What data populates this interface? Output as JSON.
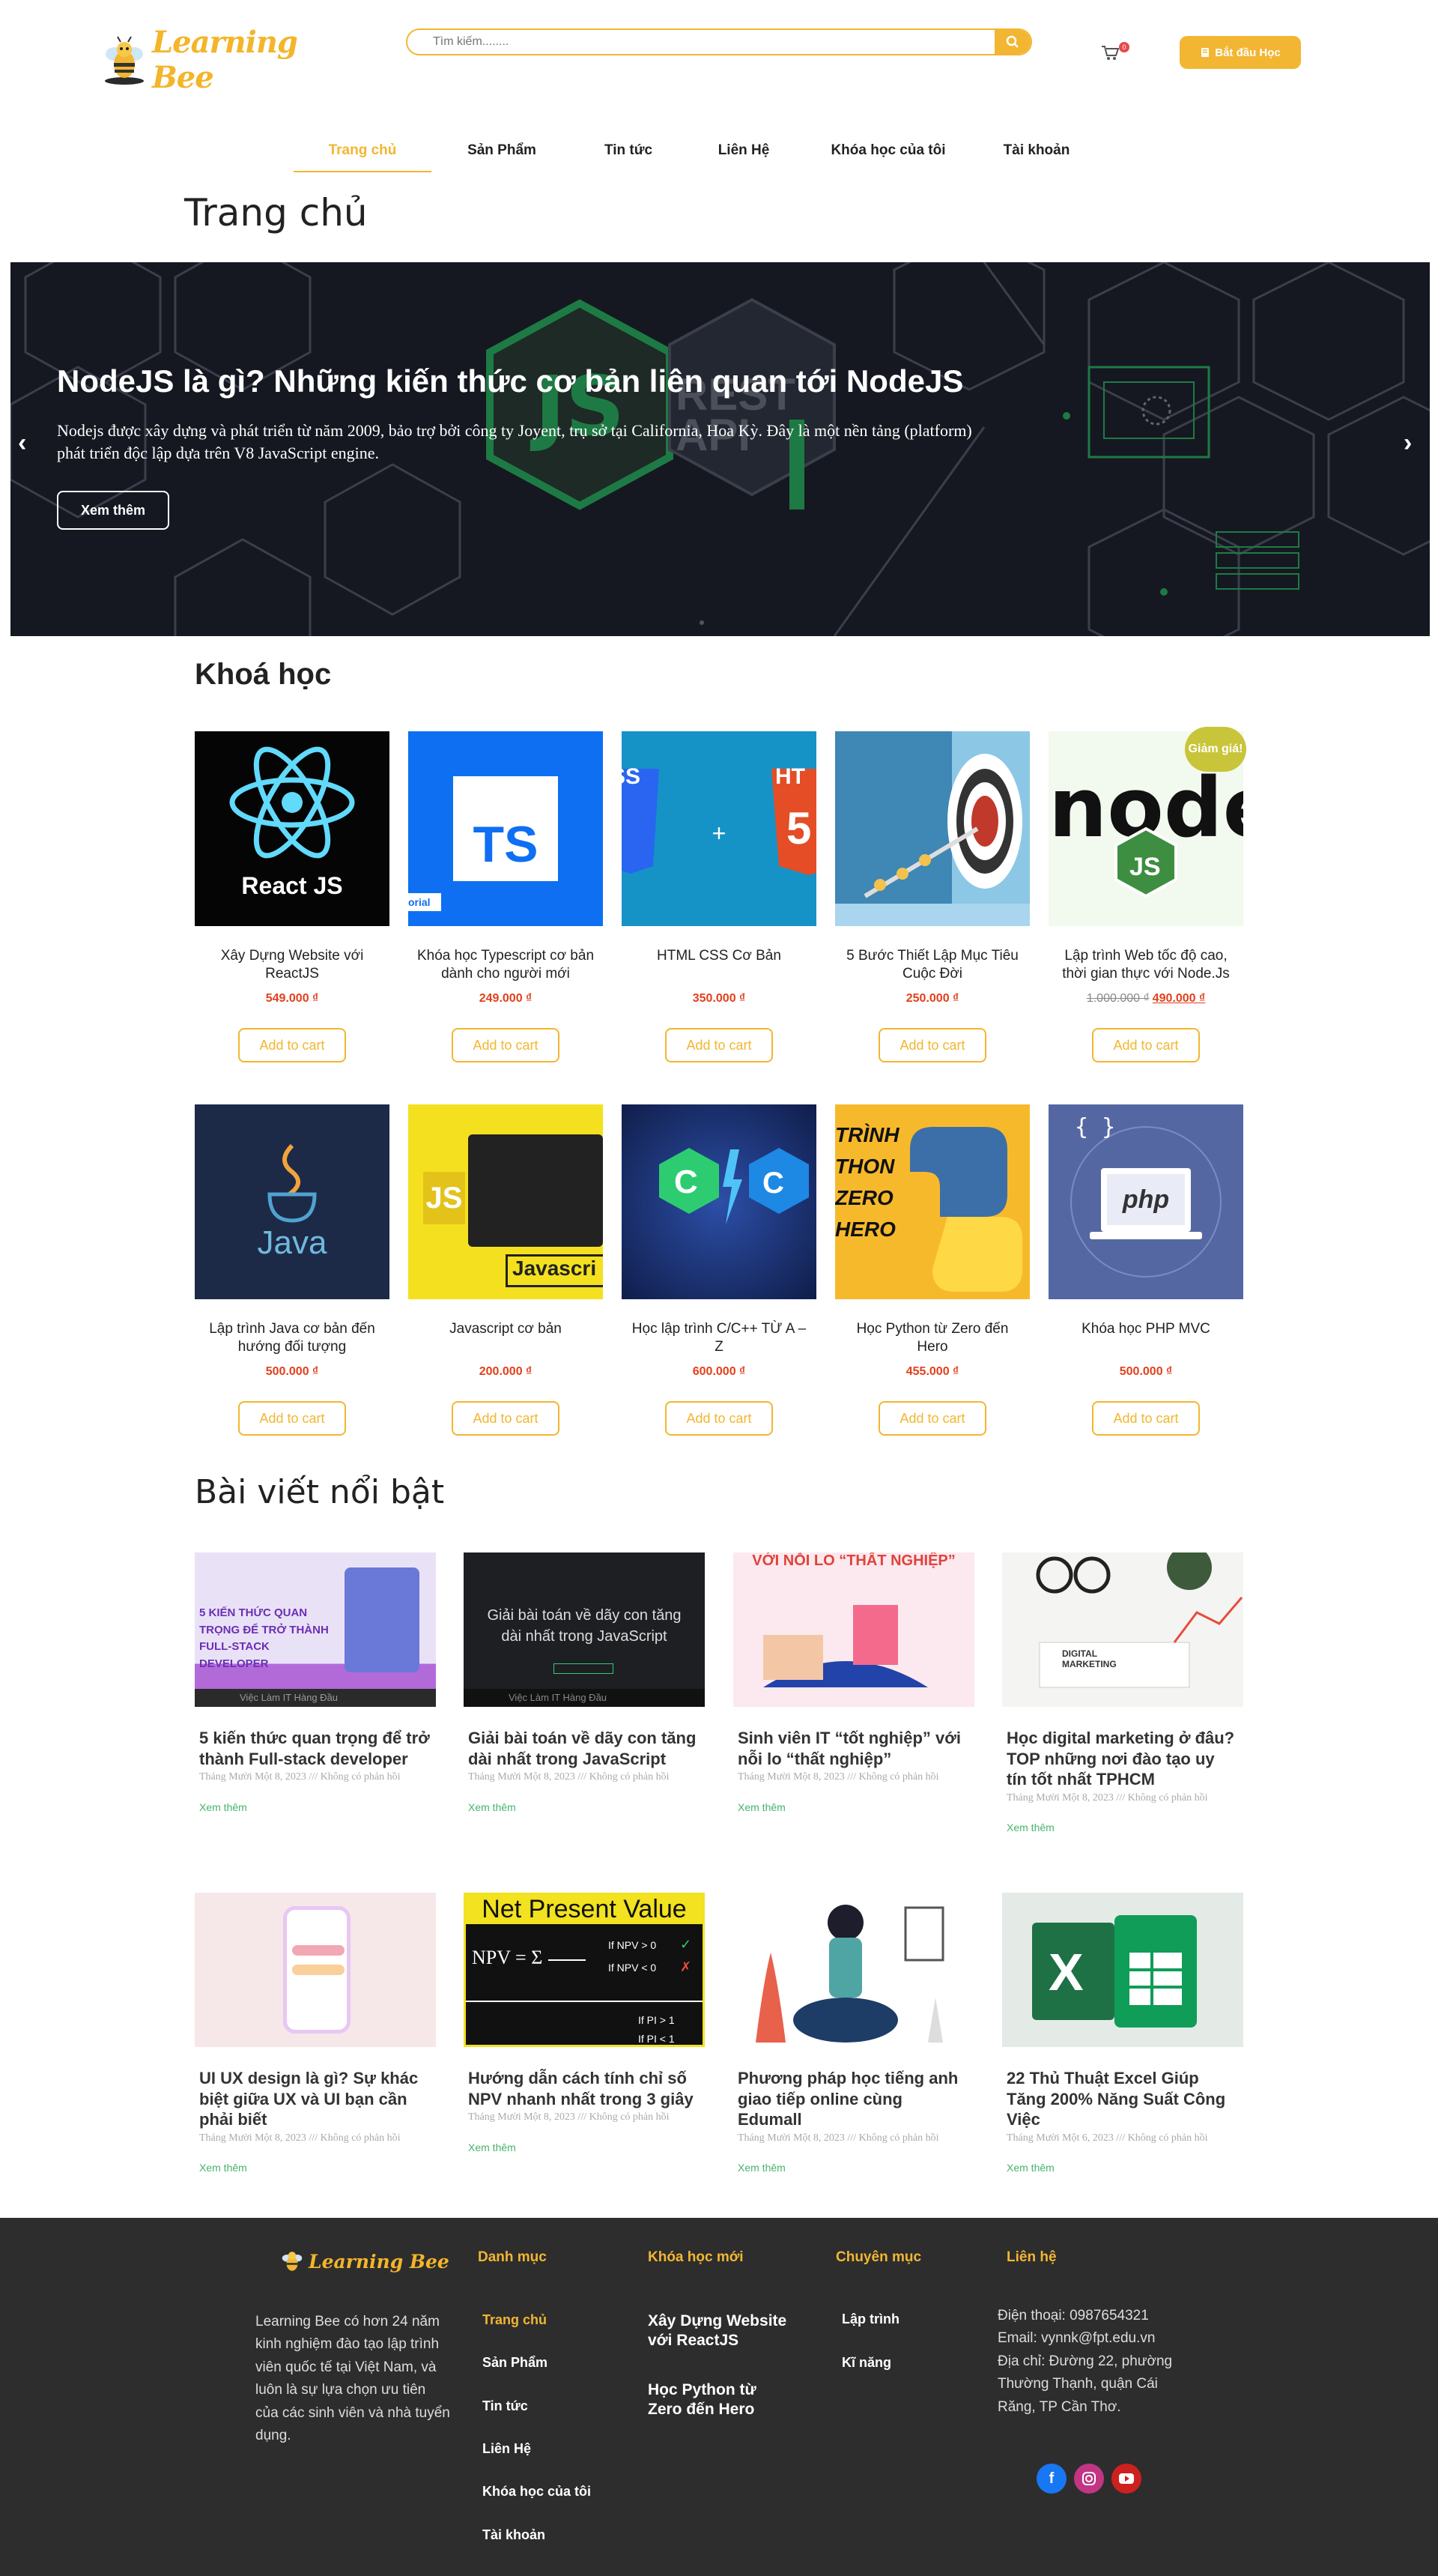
{
  "brand": {
    "name": "Learning Bee"
  },
  "search": {
    "placeholder": "Tìm kiếm........"
  },
  "cart": {
    "count": "0"
  },
  "cta": {
    "label": "Bắt đầu Học"
  },
  "nav": [
    "Trang chủ",
    "Sản Phẩm",
    "Tin tức",
    "Liên Hệ",
    "Khóa học của tôi",
    "Tài khoản"
  ],
  "page_title": "Trang chủ",
  "hero": {
    "title": "NodeJS là gì? Những kiến thức cơ bản liên quan tới NodeJS",
    "description": "Nodejs được xây dựng và phát triển từ năm 2009, bảo trợ bởi công ty Joyent, trụ sở tại California, Hoa Kỳ. Đây là một nền tảng (platform) phát triển độc lập dựa trên V8 JavaScript engine.",
    "button": "Xem thêm",
    "bg_text": "REST API"
  },
  "courses_title": "Khoá học",
  "products": [
    {
      "name": "Xây Dựng Website với ReactJS",
      "price": "549.000 ₫",
      "thumb": "React JS"
    },
    {
      "name": "Khóa học Typescript cơ bản dành cho người mới",
      "price": "249.000 ₫",
      "thumb": "TS",
      "thumb_tag": "orial"
    },
    {
      "name": "HTML CSS Cơ Bản",
      "price": "350.000 ₫",
      "thumb": "+"
    },
    {
      "name": "5 Bước Thiết Lập Mục Tiêu Cuộc Đời",
      "price": "250.000 ₫"
    },
    {
      "name": "Lập trình Web tốc độ cao, thời gian thực với Node.Js",
      "old_price": "1.000.000 ₫",
      "price": "490.000 ₫",
      "badge": "Giảm giá!"
    },
    {
      "name": "Lập trình Java cơ bản đến hướng đối tượng",
      "price": "500.000 ₫",
      "thumb": "Java"
    },
    {
      "name": "Javascript cơ bản",
      "price": "200.000 ₫",
      "thumb": "Javascri"
    },
    {
      "name": "Học lập trình C/C++ TỪ A – Z",
      "price": "600.000 ₫",
      "thumb": "C"
    },
    {
      "name": "Học Python từ Zero đến Hero",
      "price": "455.000 ₫",
      "thumb": "TRÌNH THON ZERO HERO"
    },
    {
      "name": "Khóa học PHP MVC",
      "price": "500.000 ₫",
      "thumb": "php"
    }
  ],
  "add_to_cart": "Add to cart",
  "posts_title": "Bài viết nổi bật",
  "posts": [
    {
      "title": "5 kiến thức quan trọng để trở thành Full-stack developer",
      "meta": "Tháng Mười Một 8, 2023 /// Không có phản hồi",
      "thumb": "5 KIẾN THỨC QUAN TRỌNG ĐỂ TRỞ THÀNH FULL-STACK DEVELOPER",
      "thumb_footer": "Việc Làm IT Hàng Đầu"
    },
    {
      "title": "Giải bài toán về dãy con tăng dài nhất trong JavaScript",
      "meta": "Tháng Mười Một 8, 2023 /// Không có phản hồi",
      "thumb": "Giải bài toán về dãy con tăng dài nhất trong JavaScript",
      "thumb_footer": "Việc Làm IT Hàng Đầu"
    },
    {
      "title": "Sinh viên IT “tốt nghiệp” với nỗi lo “thất nghiệp”",
      "meta": "Tháng Mười Một 8, 2023 /// Không có phản hồi",
      "thumb": "VỚI NỖI LO “THẤT NGHIỆP”"
    },
    {
      "title": "Học digital marketing ở đâu? TOP những nơi đào tạo uy tín tốt nhất TPHCM",
      "meta": "Tháng Mười Một 8, 2023 /// Không có phản hồi",
      "thumb": "DIGITAL MARKETING"
    },
    {
      "title": "UI UX design là gì? Sự khác biệt giữa UX và UI bạn cần phải biết",
      "meta": "Tháng Mười Một 8, 2023 /// Không có phản hồi"
    },
    {
      "title": "Hướng dẫn cách tính chỉ số NPV nhanh nhất trong 3 giây",
      "meta": "Tháng Mười Một 8, 2023 /// Không có phản hồi",
      "thumb": "Net Present Value"
    },
    {
      "title": "Phương pháp học tiếng anh giao tiếp online cùng Edumall",
      "meta": "Tháng Mười Một 8, 2023 /// Không có phản hồi"
    },
    {
      "title": "22 Thủ Thuật Excel Giúp Tăng 200% Năng Suất Công Việc",
      "meta": "Tháng Mười Một 6, 2023 /// Không có phản hồi"
    }
  ],
  "read_more": "Xem thêm",
  "footer": {
    "about": "Learning Bee có hơn 24 năm kinh nghiệm đào tạo lập trình viên quốc tế tại Việt Nam, và luôn là sự lựa chọn ưu tiên của các sinh viên và nhà tuyển dụng.",
    "danh_muc_title": "Danh mục",
    "danh_muc": [
      "Trang chủ",
      "Sản Phẩm",
      "Tin tức",
      "Liên Hệ",
      "Khóa học của tôi",
      "Tài khoản"
    ],
    "khoa_hoc_title": "Khóa học mới",
    "khoa_hoc": [
      "Xây Dựng Website với ReactJS",
      "Học Python từ Zero đến Hero"
    ],
    "chuyen_muc_title": "Chuyên mục",
    "chuyen_muc": [
      "Lập trình",
      "Kĩ năng"
    ],
    "lien_he_title": "Liên hệ",
    "phone": "Điện thoại: 0987654321",
    "email": "Email: vynnk@fpt.edu.vn",
    "address": "Địa chỉ: Đường 22, phường Thường Thạnh, quận Cái Răng, TP Cần Thơ.",
    "social": [
      {
        "icon": "facebook-icon",
        "color": "#1877f2"
      },
      {
        "icon": "instagram-icon",
        "color": "#c13584"
      },
      {
        "icon": "youtube-icon",
        "color": "#cd201f"
      }
    ]
  },
  "colors": {
    "accent": "#f2b632",
    "price": "#e2401c",
    "footer_bg": "#2d2d2d",
    "link_green": "#45b36b"
  }
}
